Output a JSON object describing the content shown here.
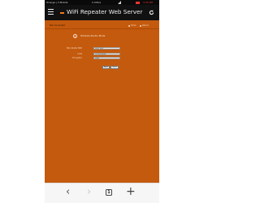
{
  "status_bar": {
    "carrier": "Orange | T-Mobile",
    "network": "0.00K/s",
    "clock": "3:36 PM"
  },
  "app_bar": {
    "title": "WiFi Repeater Web Server",
    "icons": {
      "menu": "menu-icon",
      "refresh": "refresh-icon"
    }
  },
  "page": {
    "connection_status": "Not connected",
    "links": {
      "home": "Home",
      "reboot": "Reboot"
    },
    "mode_title": "Wireless Router Mode",
    "form": {
      "fields": [
        {
          "label": "Main Router SSID",
          "value": "Super Rede"
        },
        {
          "label": "Code",
          "value": "123456789abc"
        },
        {
          "label": "Encryption",
          "value": "WPA2"
        }
      ],
      "buttons": {
        "apply": "Apply",
        "cancel": "Cancel"
      }
    }
  },
  "bottom_bar": {
    "tab_count": "1",
    "icons": {
      "back": "back-arrow-icon",
      "forward": "forward-arrow-icon",
      "new_tab": "plus-icon"
    }
  },
  "colors": {
    "page_background": "#c45a0e",
    "app_bar": "#111111",
    "brand_accent": "#f07a1a"
  }
}
